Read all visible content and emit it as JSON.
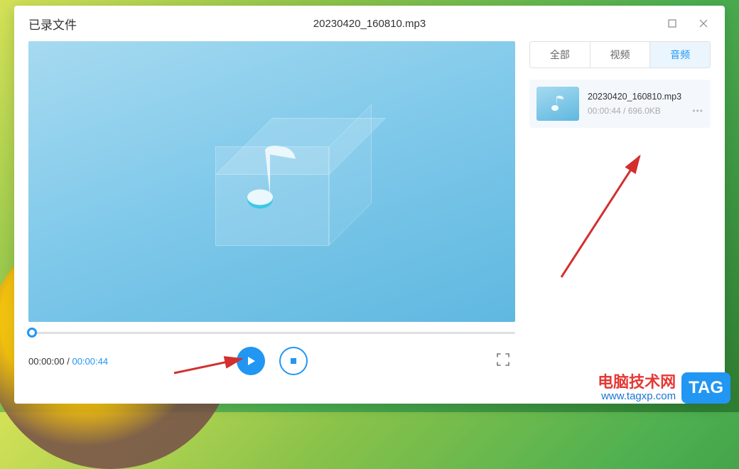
{
  "window": {
    "title_left": "已录文件",
    "title_center": "20230420_160810.mp3"
  },
  "player": {
    "current_time": "00:00:00",
    "total_time": "00:00:44"
  },
  "sidebar": {
    "tabs": {
      "all": "全部",
      "video": "视频",
      "audio": "音频"
    },
    "active_tab": "audio",
    "file": {
      "name": "20230420_160810.mp3",
      "duration": "00:00:44",
      "size": "696.0KB"
    }
  },
  "watermark": {
    "cn": "电脑技术网",
    "url": "www.tagxp.com",
    "tag": "TAG"
  }
}
